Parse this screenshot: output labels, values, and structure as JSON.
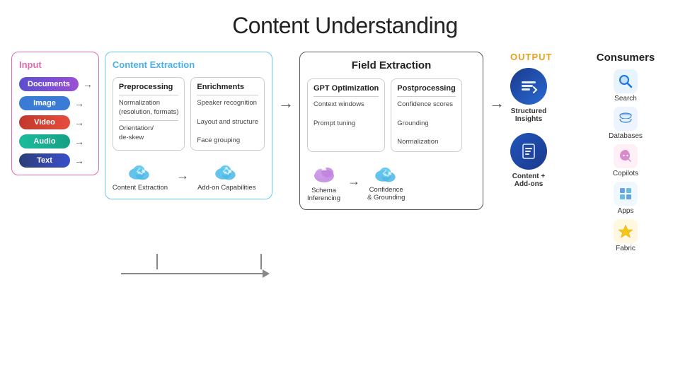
{
  "title": "Content Understanding",
  "input": {
    "section_label": "Input",
    "items": [
      {
        "label": "Documents",
        "pill_class": "pill-documents"
      },
      {
        "label": "Image",
        "pill_class": "pill-image"
      },
      {
        "label": "Video",
        "pill_class": "pill-video"
      },
      {
        "label": "Audio",
        "pill_class": "pill-audio"
      },
      {
        "label": "Text",
        "pill_class": "pill-text"
      }
    ]
  },
  "content_extraction": {
    "section_label": "Content Extraction",
    "preprocessing": {
      "title": "Preprocessing",
      "items": [
        "Normalization",
        "(resolution, formats)",
        "Orientation/",
        "de-skew"
      ]
    },
    "enrichments": {
      "title": "Enrichments",
      "items": [
        "Speaker recognition",
        "Layout and structure",
        "Face grouping"
      ]
    },
    "cloud1_label": "Content\nExtraction",
    "cloud2_label": "Add-on\nCapabilities"
  },
  "field_extraction": {
    "section_label": "Field Extraction",
    "gpt": {
      "title": "GPT Optimization",
      "items": [
        "Context windows",
        "Prompt tuning"
      ]
    },
    "postprocessing": {
      "title": "Postprocessing",
      "items": [
        "Confidence scores",
        "Grounding",
        "Normalization"
      ]
    },
    "schema_label": "Schema\nInferencing",
    "confidence_label": "Confidence\n& Grounding"
  },
  "output": {
    "section_label": "OUTPUT",
    "structured_label": "Structured\nInsights",
    "content_label": "Content +\nAdd-ons"
  },
  "consumers": {
    "section_label": "Consumers",
    "items": [
      {
        "label": "Search",
        "icon": "🔍",
        "bg": "icon-search-bg"
      },
      {
        "label": "Databases",
        "icon": "🗄",
        "bg": "icon-db-bg"
      },
      {
        "label": "Copilots",
        "icon": "🤖",
        "bg": "icon-copilot-bg"
      },
      {
        "label": "Apps",
        "icon": "🔷",
        "bg": "icon-apps-bg"
      },
      {
        "label": "Fabric",
        "icon": "⚡",
        "bg": "icon-fabric-bg"
      }
    ]
  }
}
